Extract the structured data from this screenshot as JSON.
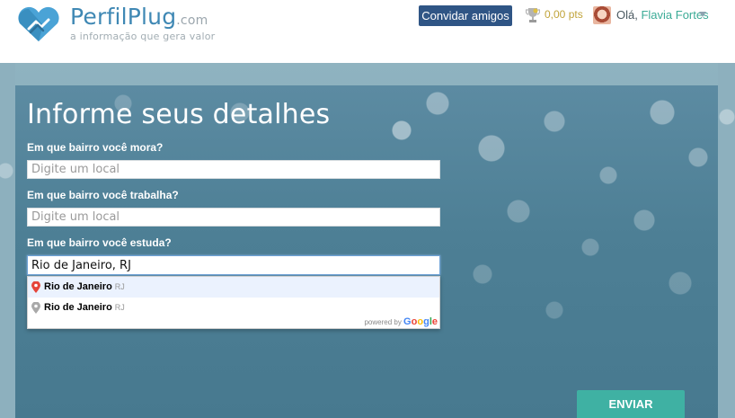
{
  "header": {
    "brand_main": "PerfilPlug",
    "brand_suffix": ".com",
    "tagline": "a informação que gera valor",
    "invite_label": "Convidar amigos",
    "points": "0,00 pts",
    "greeting_prefix": "Olá, ",
    "user_name": "Flavia Fortes"
  },
  "main": {
    "title": "Informe seus detalhes",
    "fields": [
      {
        "label": "Em que bairro você mora?",
        "value": "",
        "placeholder": "Digite um local"
      },
      {
        "label": "Em que bairro você trabalha?",
        "value": "",
        "placeholder": "Digite um local"
      },
      {
        "label": "Em que bairro você estuda?",
        "value": "Rio de Janeiro, RJ",
        "placeholder": "Digite um local"
      }
    ],
    "suggestions": [
      {
        "main": "Rio de Janeiro",
        "secondary": "RJ"
      },
      {
        "main": "Rio de Janeiro",
        "secondary": "RJ"
      }
    ],
    "powered_by": "powered by",
    "powered_brand": "Google",
    "submit_label": "ENVIAR"
  },
  "colors": {
    "brand_blue": "#3f88b4",
    "invite_button": "#2f5585",
    "submit_button": "#3fb1a3",
    "user_name": "#3bab96",
    "points": "#c1a43a"
  }
}
